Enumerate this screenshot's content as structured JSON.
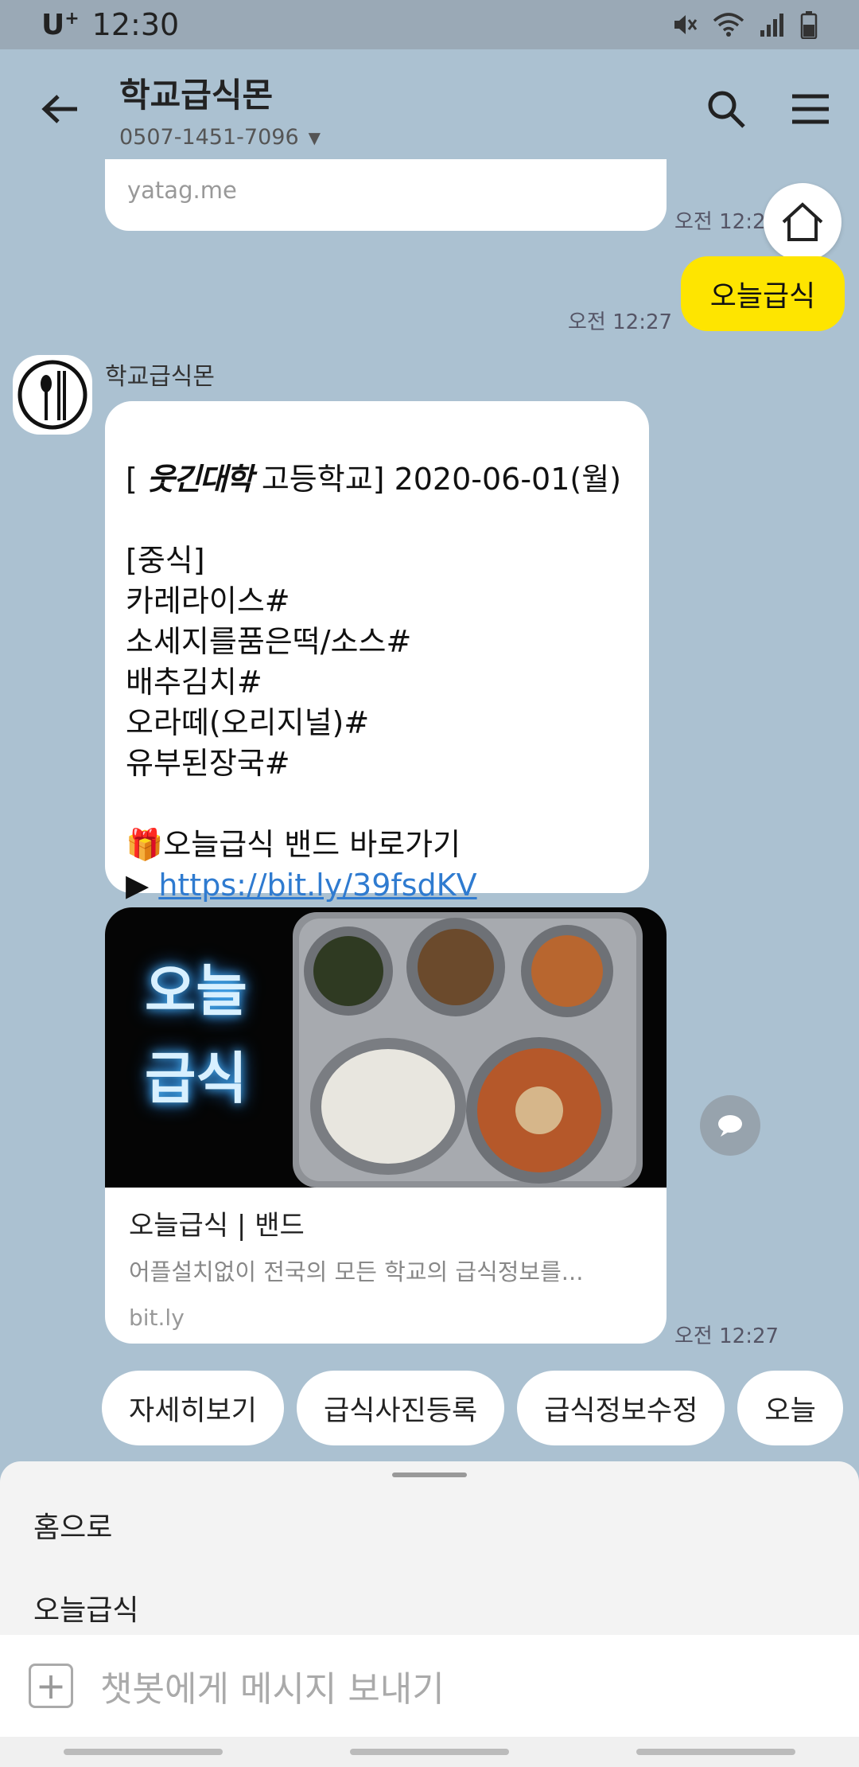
{
  "status_bar": {
    "carrier": "U",
    "carrier_sup": "+",
    "time": "12:30"
  },
  "header": {
    "title": "학교급식몬",
    "phone": "0507-1451-7096"
  },
  "messages": {
    "link_preview_domain": "yatag.me",
    "ts_top": "오전 12:2",
    "my_message": "오늘급식",
    "ts_my": "오전 12:27",
    "sender_name": "학교급식몬",
    "menu_school_scribble": "웃긴대학",
    "menu_head": "[ 웃긴대학 고등학교] 2020-06-01(월)",
    "menu_head_rest": " 고등학교] 2020-06-01(월)",
    "menu_body": "\n[중식]\n카레라이스#\n소세지를품은떡/소스#\n배추김치#\n오라떼(오리지널)#\n유부된장국#\n\n",
    "band_line": "🎁오늘급식 밴드 바로가기",
    "arrow": "▶ ",
    "link_text": "https://bit.ly/39fsdKV",
    "card_image_text_1": "오늘",
    "card_image_text_2": "급식",
    "card_title": "오늘급식 | 밴드",
    "card_desc": "어플설치없이 전국의 모든 학교의 급식정보를...",
    "card_domain": "bit.ly",
    "ts_card": "오전 12:27"
  },
  "quick_replies": [
    "자세히보기",
    "급식사진등록",
    "급식정보수정",
    "오늘"
  ],
  "sheet": {
    "item1": "홈으로",
    "item2": "오늘급식"
  },
  "input": {
    "placeholder": "챗봇에게 메시지 보내기"
  },
  "colors": {
    "background": "#abc1d1",
    "my_bubble": "#fee500",
    "link": "#2f7bd0"
  }
}
